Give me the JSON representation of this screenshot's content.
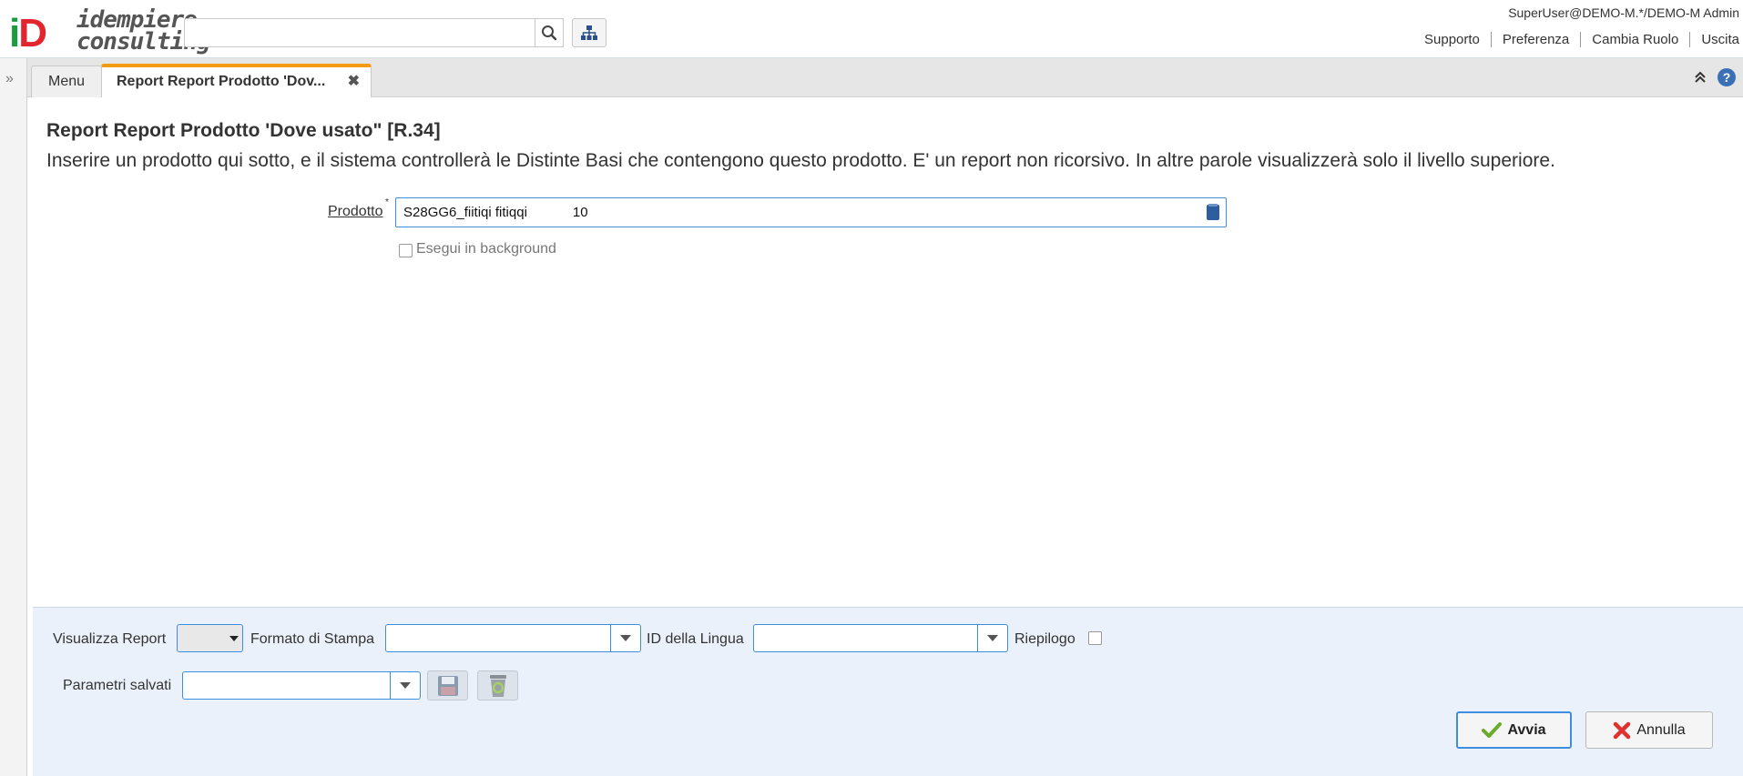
{
  "app": {
    "logo_letters": "iD",
    "logo_line1": "idempiere",
    "logo_line2": "consulting"
  },
  "header": {
    "user": "SuperUser@DEMO-M.*/DEMO-M Admin",
    "links": [
      "Supporto",
      "Preferenza",
      "Cambia Ruolo",
      "Uscita"
    ],
    "search_value": ""
  },
  "tabs": [
    {
      "label": "Menu"
    },
    {
      "label": "Report Report Prodotto 'Dov...",
      "active": true
    }
  ],
  "form": {
    "title": "Report Report Prodotto 'Dove usato\" [R.34]",
    "description": "Inserire un prodotto qui sotto, e il sistema controllerà le Distinte Basi che contengono questo prodotto. E' un report non ricorsivo. In altre parole visualizzerà solo il livello superiore.",
    "product_label": "Prodotto",
    "required_mark": "*",
    "product_value": "S28GG6_fiitiqi fitiqqi            10",
    "background_label": "Esegui in background",
    "background_checked": false
  },
  "options": {
    "view_report_label": "Visualizza Report",
    "view_report_value": "",
    "print_format_label": "Formato di Stampa",
    "print_format_value": "",
    "language_label": "ID della Lingua",
    "language_value": "",
    "summary_label": "Riepilogo",
    "summary_checked": false,
    "saved_params_label": "Parametri salvati",
    "saved_params_value": ""
  },
  "buttons": {
    "ok": "Avvia",
    "cancel": "Annulla"
  },
  "colors": {
    "accent": "#3d8ee0",
    "active_tab": "#f39c12",
    "panel_bg": "#eaf1fb"
  }
}
